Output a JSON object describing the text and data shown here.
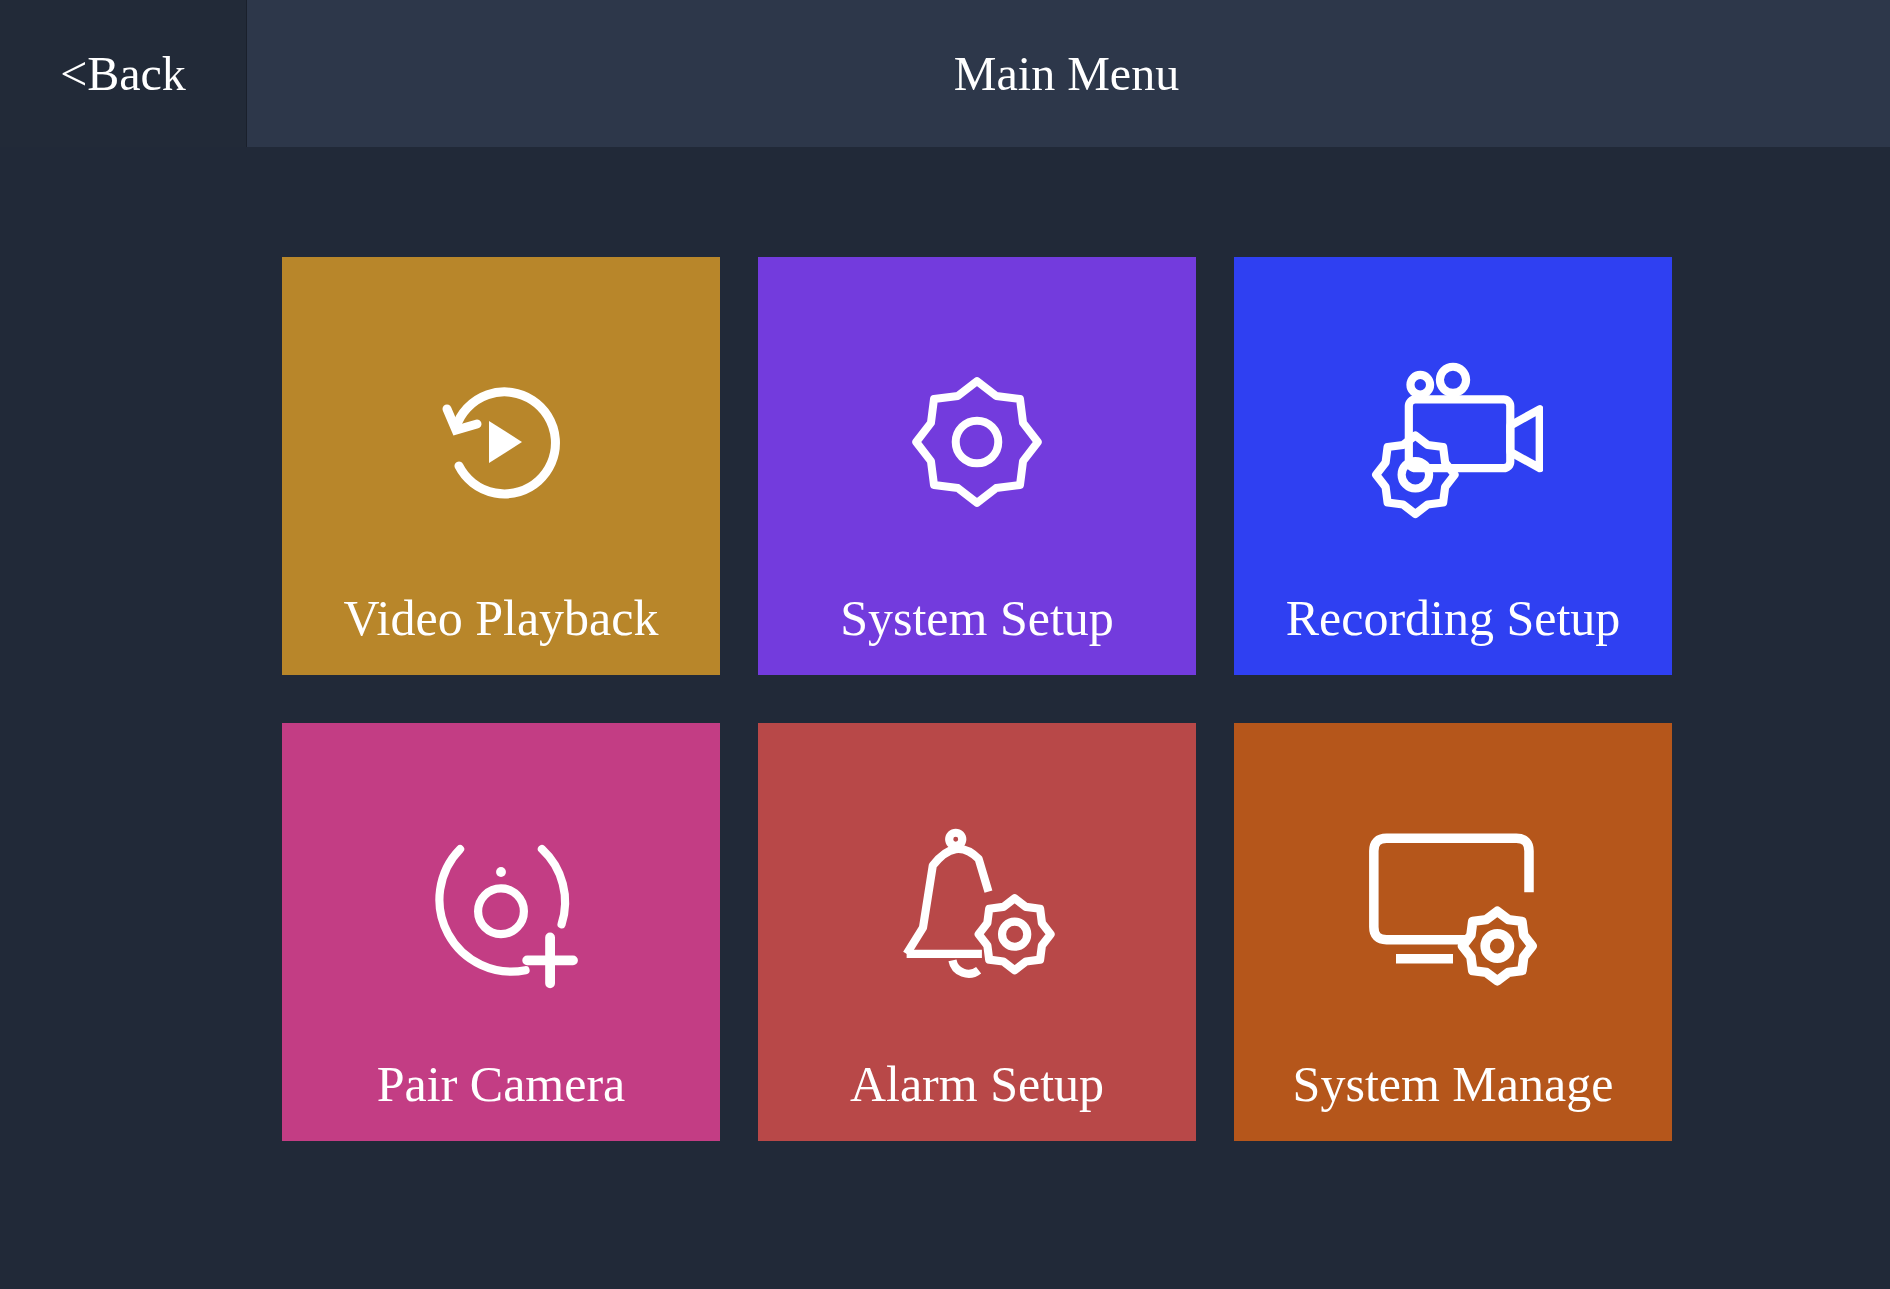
{
  "header": {
    "back": "<Back",
    "title": "Main Menu"
  },
  "tiles": [
    {
      "label": "Video Playback",
      "color": "#b8862a",
      "kind": "playback"
    },
    {
      "label": "System Setup",
      "color": "#733bdd",
      "kind": "gear"
    },
    {
      "label": "Recording Setup",
      "color": "#2f40f2",
      "kind": "camera"
    },
    {
      "label": "Pair Camera",
      "color": "#c33d84",
      "kind": "pair"
    },
    {
      "label": "Alarm Setup",
      "color": "#b84848",
      "kind": "bell"
    },
    {
      "label": "System Manage",
      "color": "#b5561b",
      "kind": "monitor"
    }
  ]
}
